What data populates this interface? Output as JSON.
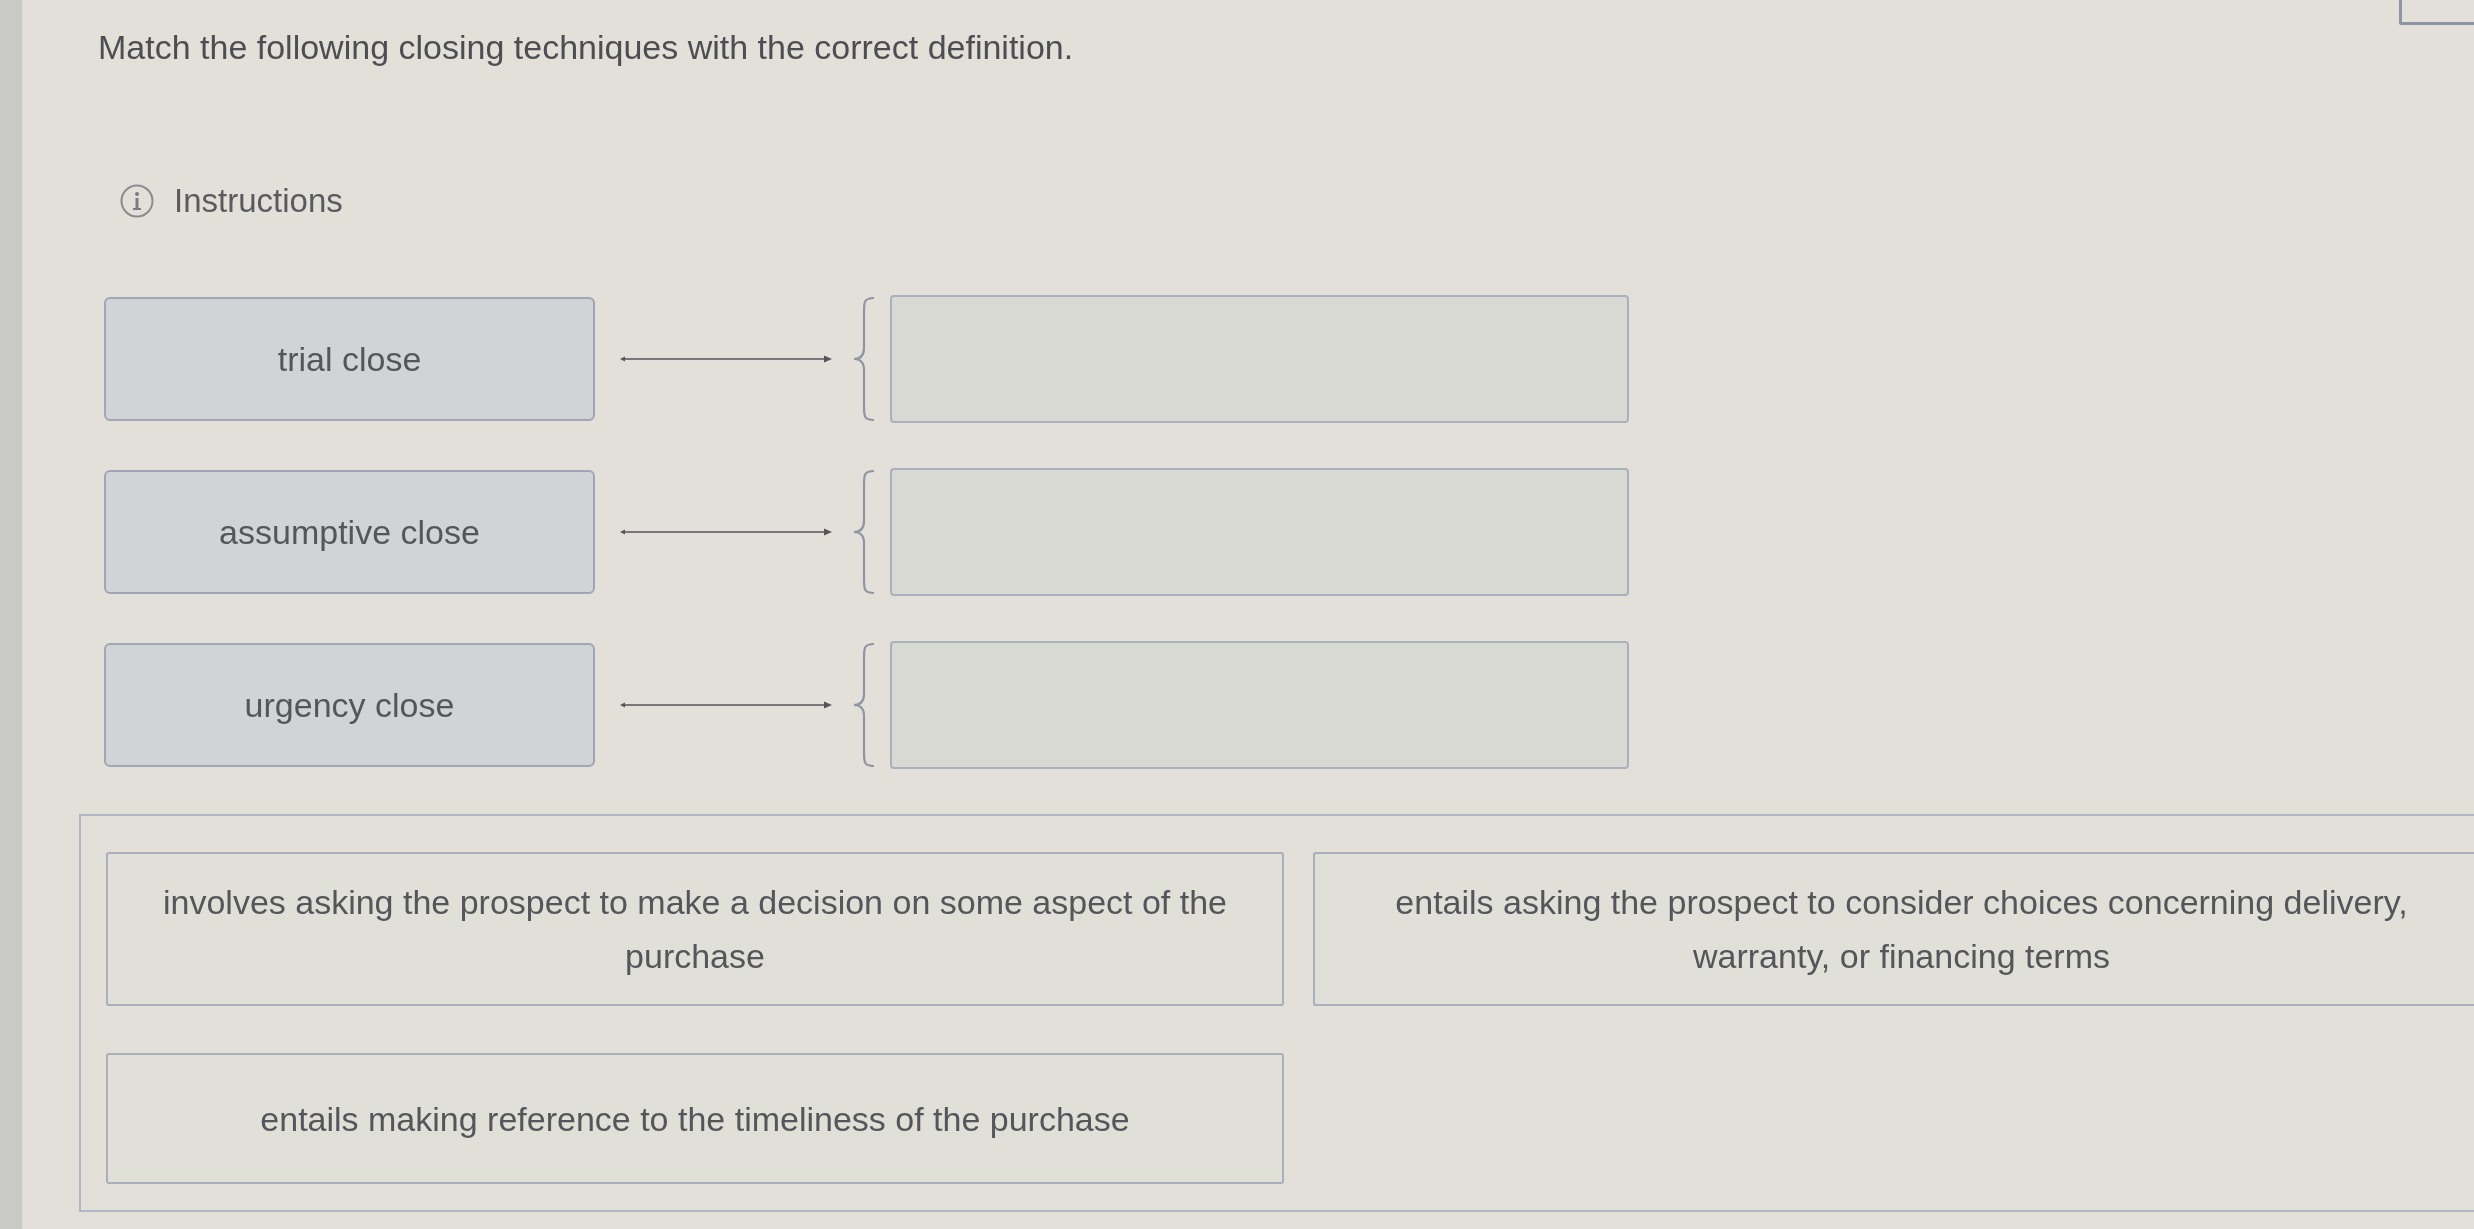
{
  "question": {
    "prompt": "Match the following closing techniques with the correct definition."
  },
  "instructions": {
    "label": "Instructions"
  },
  "matching_rows": [
    {
      "term": "trial close"
    },
    {
      "term": "assumptive close"
    },
    {
      "term": "urgency close"
    }
  ],
  "answer_bank": [
    {
      "text": "involves asking the prospect to make a decision on some aspect of the purchase"
    },
    {
      "text": "entails asking the prospect to consider choices concerning delivery, warranty, or financing terms"
    },
    {
      "text": "entails making reference to the timeliness of the purchase"
    }
  ]
}
